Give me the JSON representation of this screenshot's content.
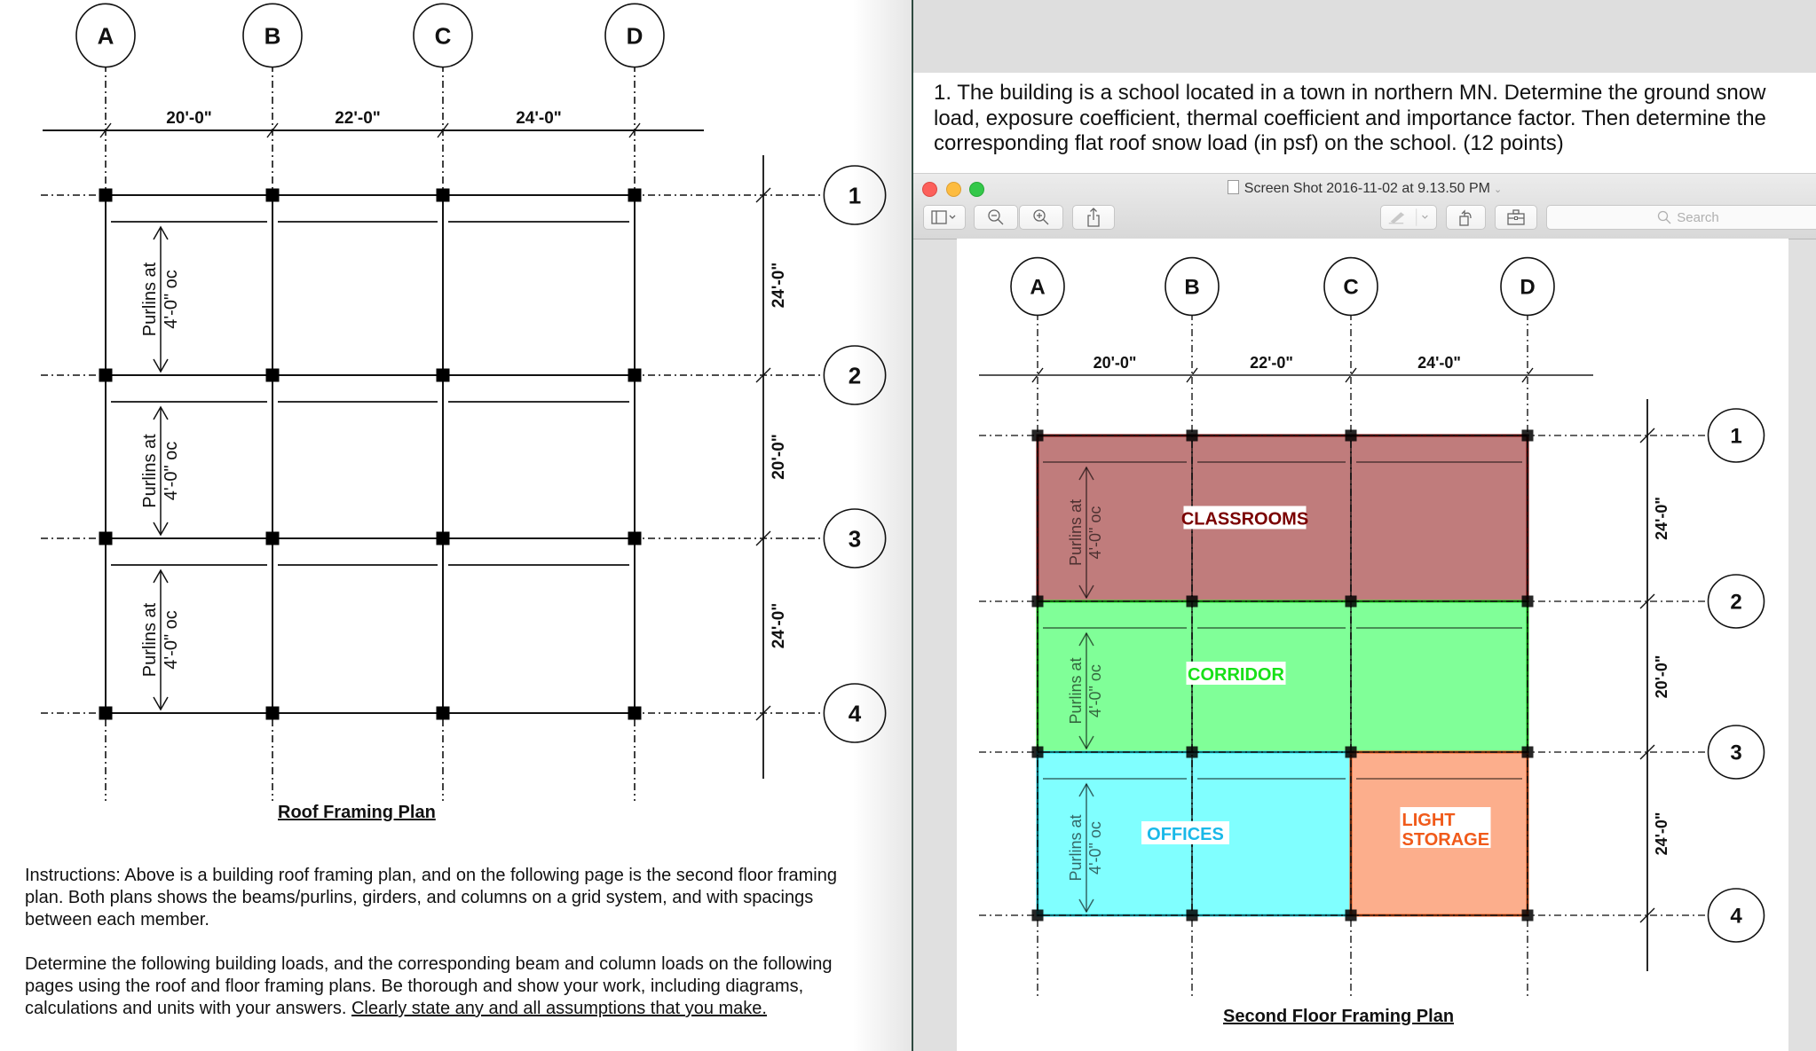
{
  "left_document": {
    "plan": {
      "column_labels": [
        "A",
        "B",
        "C",
        "D"
      ],
      "row_labels": [
        "1",
        "2",
        "3",
        "4"
      ],
      "column_spacings": [
        "20'-0\"",
        "22'-0\"",
        "24'-0\""
      ],
      "row_spacings": [
        "24'-0\"",
        "20'-0\"",
        "24'-0\""
      ],
      "purlin_note_line1": "Purlins at",
      "purlin_note_line2": "4'-0\" oc"
    },
    "caption": "Roof Framing Plan",
    "instructions_para1": "Instructions: Above is a building roof framing plan, and on the following page is the second floor framing plan.  Both plans shows the beams/purlins, girders, and columns on a grid system, and with spacings between each member.",
    "instructions_para2_plain": "Determine the following building loads, and the corresponding beam and column loads on the following pages using the roof and floor framing plans.  Be thorough and show your work, including diagrams, calculations and units with your answers.  ",
    "instructions_para2_underlined": "Clearly state any and all assumptions that you make."
  },
  "right_document": {
    "question": "1. The building is a school located in a town in northern MN.  Determine the ground snow load, exposure coefficient, thermal coefficient and importance factor.  Then determine the corresponding flat roof snow load (in psf) on the school.  (12 points)"
  },
  "preview_window": {
    "title": "Screen Shot 2016-11-02 at 9.13.50 PM",
    "search_placeholder": "Search",
    "toolbar": {
      "sidebar_icon": "sidebar-icon",
      "zoom_out_icon": "zoom-out-icon",
      "zoom_in_icon": "zoom-in-icon",
      "share_icon": "share-icon",
      "markup_icon": "pen-icon",
      "rotate_icon": "rotate-icon",
      "toolbox_icon": "toolbox-icon"
    },
    "plan": {
      "column_labels": [
        "A",
        "B",
        "C",
        "D"
      ],
      "row_labels": [
        "1",
        "2",
        "3",
        "4"
      ],
      "column_spacings": [
        "20'-0\"",
        "22'-0\"",
        "24'-0\""
      ],
      "row_spacings": [
        "24'-0\"",
        "20'-0\"",
        "24'-0\""
      ],
      "purlin_note_line1": "Purlins at",
      "purlin_note_line2": "4'-0\" oc",
      "zones": [
        {
          "label": "CLASSROOMS",
          "fill": "#c07c7c",
          "stroke": "#7a0000",
          "text_color": "#7a0000"
        },
        {
          "label": "CORRIDOR",
          "fill": "#80ff98",
          "stroke": "#1ee01e",
          "text_color": "#18e018"
        },
        {
          "label": "OFFICES",
          "fill": "#80ffff",
          "stroke": "#22e0f0",
          "text_color": "#1ab8e8"
        },
        {
          "label": "LIGHT STORAGE",
          "label_line1": "LIGHT",
          "label_line2": "STORAGE",
          "fill": "#fcae8c",
          "stroke": "#f05a1a",
          "text_color": "#f05a1a"
        }
      ]
    },
    "caption": "Second Floor Framing Plan"
  }
}
